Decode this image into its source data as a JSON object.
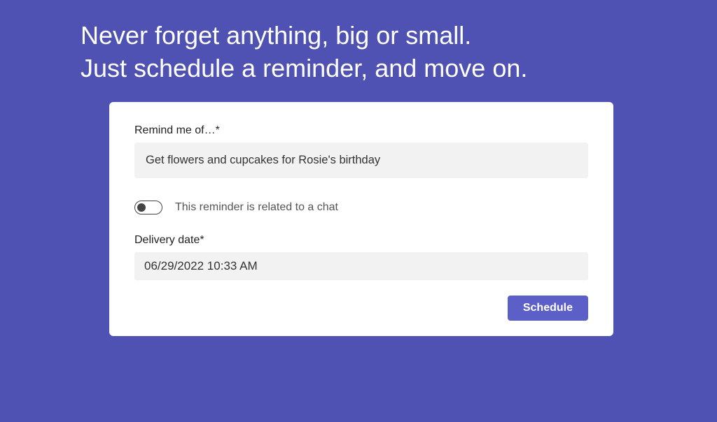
{
  "headline": {
    "line1": "Never forget anything, big or small.",
    "line2": "Just schedule a reminder, and move on."
  },
  "form": {
    "remind_label": "Remind me of…*",
    "remind_value": "Get flowers and cupcakes for Rosie's birthday",
    "toggle_label": "This reminder is related to a chat",
    "toggle_on": false,
    "date_label": "Delivery date*",
    "date_value": "06/29/2022 10:33 AM",
    "schedule_label": "Schedule"
  },
  "colors": {
    "background": "#4f52b2",
    "accent": "#5b5fc7"
  }
}
